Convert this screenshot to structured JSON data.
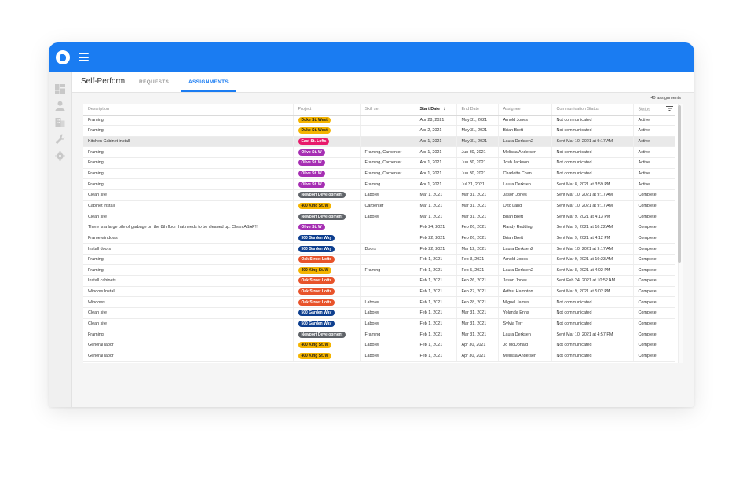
{
  "app": {
    "title": "Self-Perform"
  },
  "tabs": [
    {
      "label": "REQUESTS",
      "active": false
    },
    {
      "label": "ASSIGNMENTS",
      "active": true
    }
  ],
  "sidebar": {
    "items": [
      {
        "icon": "dashboard-icon"
      },
      {
        "icon": "person-icon"
      },
      {
        "icon": "building-icon"
      },
      {
        "icon": "wrench-icon"
      },
      {
        "icon": "gear-icon"
      }
    ]
  },
  "assignments_count": "40 assignments",
  "colors": {
    "brand": "#1a7cf2",
    "chip_yellow": "#f4b400",
    "chip_pink": "#e8196b",
    "chip_purple": "#a62fb3",
    "chip_gray": "#5f6368",
    "chip_navy": "#0e3f8f",
    "chip_orange": "#e8532a"
  },
  "table": {
    "columns": [
      "Description",
      "Project",
      "Skill set",
      "Start Date",
      "End Date",
      "Assignee",
      "Communication Status",
      "Status"
    ],
    "sorted_column": "Start Date",
    "rows": [
      {
        "description": "Framing",
        "project": "Duke St. West",
        "chip": "yellow",
        "skill": "",
        "start": "Apr 28, 2021",
        "end": "May 31, 2021",
        "assignee": "Arnold Jones",
        "comm": "Not communicated",
        "status": "Active"
      },
      {
        "description": "Framing",
        "project": "Duke St. West",
        "chip": "yellow",
        "skill": "",
        "start": "Apr 2, 2021",
        "end": "May 31, 2021",
        "assignee": "Brian Brett",
        "comm": "Not communicated",
        "status": "Active"
      },
      {
        "description": "Kitchen Cabinet install",
        "project": "East St. Lofts",
        "chip": "pink",
        "skill": "",
        "start": "Apr 1, 2021",
        "end": "May 31, 2021",
        "assignee": "Laura Derksen2",
        "comm": "Sent Mar 10, 2021 at 9:17 AM",
        "status": "Active",
        "highlight": true
      },
      {
        "description": "Framing",
        "project": "Olive St. W",
        "chip": "purple",
        "skill": "Framing, Carpenter",
        "start": "Apr 1, 2021",
        "end": "Jun 30, 2021",
        "assignee": "Melissa Andersen",
        "comm": "Not communicated",
        "status": "Active"
      },
      {
        "description": "Framing",
        "project": "Olive St. W",
        "chip": "purple",
        "skill": "Framing, Carpenter",
        "start": "Apr 1, 2021",
        "end": "Jun 30, 2021",
        "assignee": "Josh Jackson",
        "comm": "Not communicated",
        "status": "Active"
      },
      {
        "description": "Framing",
        "project": "Olive St. W",
        "chip": "purple",
        "skill": "Framing, Carpenter",
        "start": "Apr 1, 2021",
        "end": "Jun 30, 2021",
        "assignee": "Charlotte Chan",
        "comm": "Not communicated",
        "status": "Active"
      },
      {
        "description": "Framing",
        "project": "Olive St. W",
        "chip": "purple",
        "skill": "Framing",
        "start": "Apr 1, 2021",
        "end": "Jul 31, 2021",
        "assignee": "Laura Derksen",
        "comm": "Sent Mar 8, 2021 at 3:59 PM",
        "status": "Active"
      },
      {
        "description": "Clean site",
        "project": "Newport Development",
        "chip": "gray",
        "skill": "Laborer",
        "start": "Mar 1, 2021",
        "end": "Mar 31, 2021",
        "assignee": "Jason Jones",
        "comm": "Sent Mar 10, 2021 at 9:17 AM",
        "status": "Complete"
      },
      {
        "description": "Cabinet install",
        "project": "400 King St. W",
        "chip": "yellow",
        "skill": "Carpenter",
        "start": "Mar 1, 2021",
        "end": "Mar 31, 2021",
        "assignee": "Otto Lang",
        "comm": "Sent Mar 10, 2021 at 9:17 AM",
        "status": "Complete"
      },
      {
        "description": "Clean site",
        "project": "Newport Development",
        "chip": "gray",
        "skill": "Laborer",
        "start": "Mar 1, 2021",
        "end": "Mar 31, 2021",
        "assignee": "Brian Brett",
        "comm": "Sent Mar 9, 2021 at 4:13 PM",
        "status": "Complete"
      },
      {
        "description": "There is a large pile of garbage on the 8th floor that needs to be cleaned up. Clean ASAP!!",
        "project": "Olive St. W",
        "chip": "purple",
        "skill": "",
        "start": "Feb 24, 2021",
        "end": "Feb 26, 2021",
        "assignee": "Randy Redding",
        "comm": "Sent Mar 9, 2021 at 10:22 AM",
        "status": "Complete"
      },
      {
        "description": "Frame windows",
        "project": "500 Garden Way",
        "chip": "navy",
        "skill": "",
        "start": "Feb 22, 2021",
        "end": "Feb 26, 2021",
        "assignee": "Brian Brett",
        "comm": "Sent Mar 9, 2021 at 4:12 PM",
        "status": "Complete"
      },
      {
        "description": "Install doors",
        "project": "500 Garden Way",
        "chip": "navy",
        "skill": "Doors",
        "start": "Feb 22, 2021",
        "end": "Mar 12, 2021",
        "assignee": "Laura Derksen2",
        "comm": "Sent Mar 10, 2021 at 9:17 AM",
        "status": "Complete"
      },
      {
        "description": "Framing",
        "project": "Oak Street Lofts",
        "chip": "orange",
        "skill": "",
        "start": "Feb 1, 2021",
        "end": "Feb 3, 2021",
        "assignee": "Arnold Jones",
        "comm": "Sent Mar 9, 2021 at 10:23 AM",
        "status": "Complete"
      },
      {
        "description": "Framing",
        "project": "400 King St. W",
        "chip": "yellow",
        "skill": "Framing",
        "start": "Feb 1, 2021",
        "end": "Feb 5, 2021",
        "assignee": "Laura Derksen2",
        "comm": "Sent Mar 8, 2021 at 4:02 PM",
        "status": "Complete"
      },
      {
        "description": "Install cabinets",
        "project": "Oak Street Lofts",
        "chip": "orange",
        "skill": "",
        "start": "Feb 1, 2021",
        "end": "Feb 26, 2021",
        "assignee": "Jason Jones",
        "comm": "Sent Feb 24, 2021 at 10:52 AM",
        "status": "Complete"
      },
      {
        "description": "Window Install",
        "project": "Oak Street Lofts",
        "chip": "orange",
        "skill": "",
        "start": "Feb 1, 2021",
        "end": "Feb 27, 2021",
        "assignee": "Arthur Hampton",
        "comm": "Sent Mar 9, 2021 at 5:02 PM",
        "status": "Complete"
      },
      {
        "description": "Windows",
        "project": "Oak Street Lofts",
        "chip": "orange",
        "skill": "Laborer",
        "start": "Feb 1, 2021",
        "end": "Feb 28, 2021",
        "assignee": "Miguel James",
        "comm": "Not communicated",
        "status": "Complete"
      },
      {
        "description": "Clean site",
        "project": "500 Garden Way",
        "chip": "navy",
        "skill": "Laborer",
        "start": "Feb 1, 2021",
        "end": "Mar 31, 2021",
        "assignee": "Yolanda Enns",
        "comm": "Not communicated",
        "status": "Complete"
      },
      {
        "description": "Clean site",
        "project": "500 Garden Way",
        "chip": "navy",
        "skill": "Laborer",
        "start": "Feb 1, 2021",
        "end": "Mar 31, 2021",
        "assignee": "Sylvia Terr",
        "comm": "Not communicated",
        "status": "Complete"
      },
      {
        "description": "Framing",
        "project": "Newport Development",
        "chip": "gray",
        "skill": "Framing",
        "start": "Feb 1, 2021",
        "end": "Mar 31, 2021",
        "assignee": "Laura Derksen",
        "comm": "Sent Mar 10, 2021 at 4:57 PM",
        "status": "Complete"
      },
      {
        "description": "General labor",
        "project": "400 King St. W",
        "chip": "yellow",
        "skill": "Laborer",
        "start": "Feb 1, 2021",
        "end": "Apr 30, 2021",
        "assignee": "Jo McDonald",
        "comm": "Not communicated",
        "status": "Complete"
      },
      {
        "description": "General labor",
        "project": "400 King St. W",
        "chip": "yellow",
        "skill": "Laborer",
        "start": "Feb 1, 2021",
        "end": "Apr 30, 2021",
        "assignee": "Melissa Andersen",
        "comm": "Not communicated",
        "status": "Complete"
      }
    ]
  }
}
